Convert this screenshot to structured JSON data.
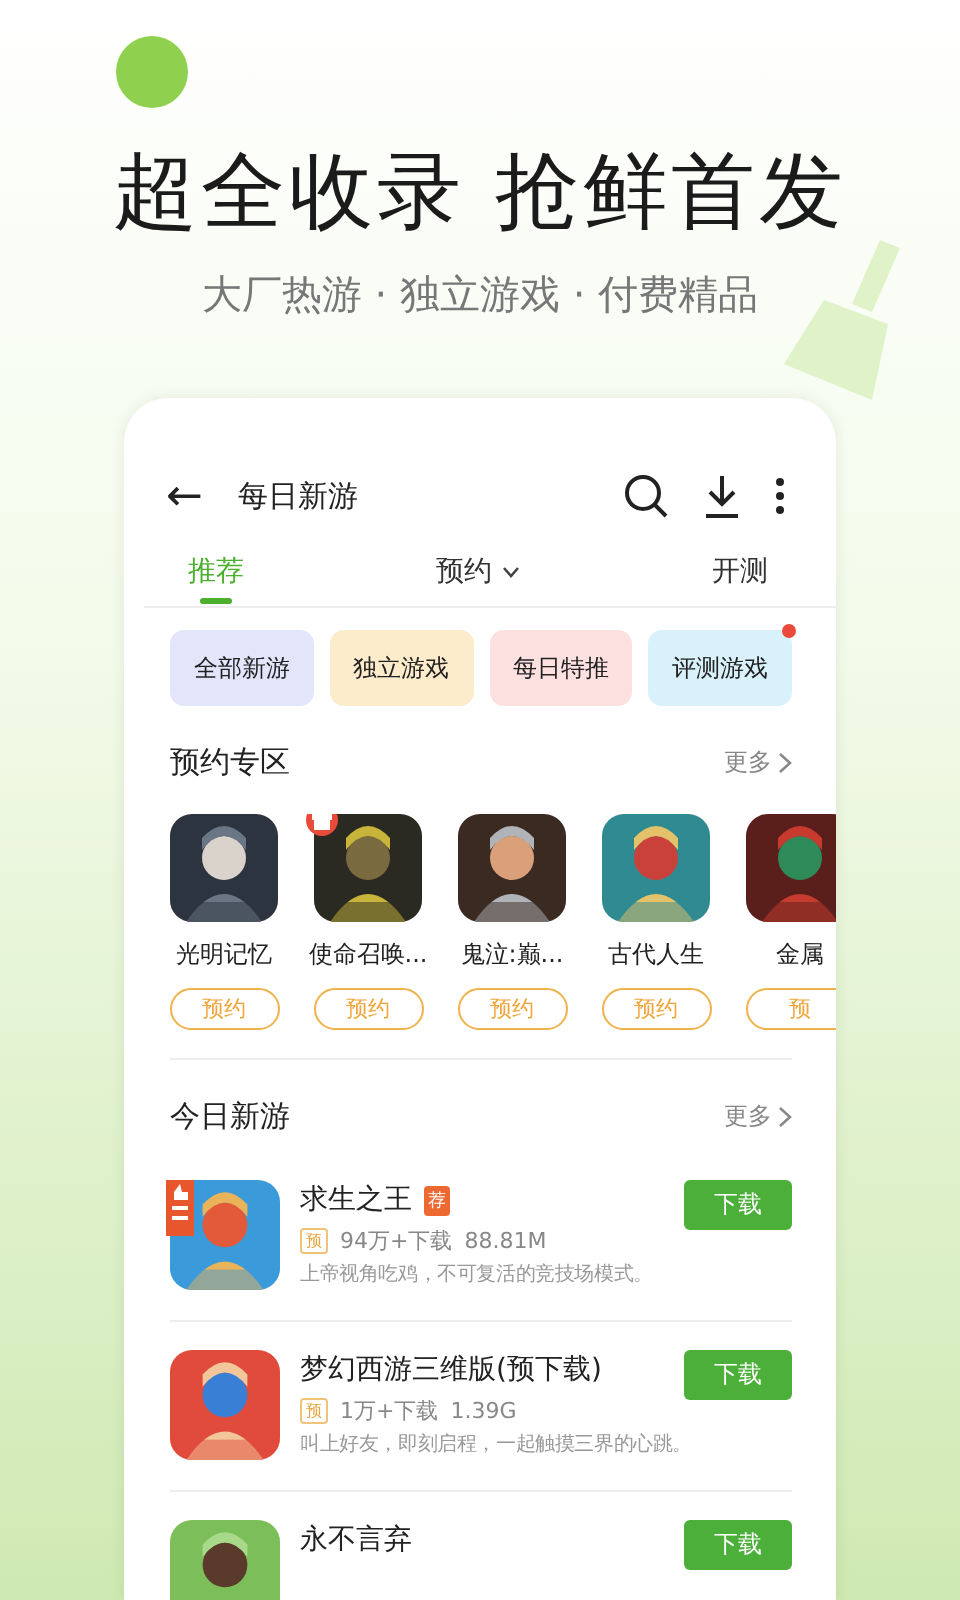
{
  "banner": {
    "headline": "超全收录 抢鲜首发",
    "subtitle": "大厂热游 · 独立游戏 · 付费精品"
  },
  "top_bar": {
    "back": "←",
    "title": "每日新游"
  },
  "tabs": [
    {
      "label": "推荐",
      "selected": true,
      "dropdown": false
    },
    {
      "label": "预约",
      "selected": false,
      "dropdown": true
    },
    {
      "label": "开测",
      "selected": false,
      "dropdown": false
    }
  ],
  "categories": [
    {
      "label": "全部新游",
      "color": "#e3e6fb",
      "dot": false
    },
    {
      "label": "独立游戏",
      "color": "#fdeccb",
      "dot": false
    },
    {
      "label": "每日特推",
      "color": "#fde0e0",
      "dot": false
    },
    {
      "label": "评测游戏",
      "color": "#d9f1fb",
      "dot": true
    }
  ],
  "reserve_section": {
    "title": "预约专区",
    "more": "更多",
    "games": [
      {
        "name": "光明记忆",
        "button": "预约",
        "gift": false
      },
      {
        "name": "使命召唤...",
        "button": "预约",
        "gift": true
      },
      {
        "name": "鬼泣:巅...",
        "button": "预约",
        "gift": false
      },
      {
        "name": "古代人生",
        "button": "预约",
        "gift": false
      },
      {
        "name": "金属",
        "button": "预",
        "gift": false
      }
    ]
  },
  "new_section": {
    "title": "今日新游",
    "more": "更多",
    "games": [
      {
        "name": "求生之王",
        "badge": "荐",
        "featured": true,
        "tag": "预",
        "downloads": "94万+下载",
        "size": "88.81M",
        "description": "上帝视角吃鸡，不可复活的竞技场模式。",
        "button": "下载"
      },
      {
        "name": "梦幻西游三维版(预下载)",
        "featured": false,
        "tag": "预",
        "downloads": "1万+下载",
        "size": "1.39G",
        "description": "叫上好友，即刻启程，一起触摸三界的心跳。",
        "button": "下载"
      },
      {
        "name": "永不言弃",
        "featured": false,
        "button": "下载"
      }
    ]
  }
}
